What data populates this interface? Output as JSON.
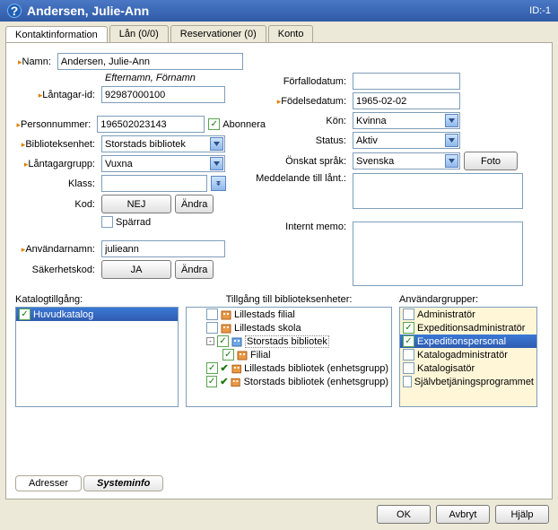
{
  "title": "Andersen, Julie-Ann",
  "id_label": "ID:-1",
  "tabs": [
    "Kontaktinformation",
    "Lån (0/0)",
    "Reservationer (0)",
    "Konto"
  ],
  "labels": {
    "namn": "Namn:",
    "efternamn_hint": "Efternamn, Förnamn",
    "lantagarid": "Låntagar-id:",
    "personnummer": "Personnummer:",
    "abonnera": "Abonnera",
    "biblioteksenhet": "Biblioteksenhet:",
    "lantagargrupp": "Låntagargrupp:",
    "klass": "Klass:",
    "kod": "Kod:",
    "sparrad": "Spärrad",
    "anvandarnamn": "Användarnamn:",
    "sakerhetskod": "Säkerhetskod:",
    "forfallodatum": "Förfallodatum:",
    "fodelsedatum": "Födelsedatum:",
    "kon": "Kön:",
    "status": "Status:",
    "onskat_sprak": "Önskat språk:",
    "meddelande": "Meddelande till lånt.:",
    "internt_memo": "Internt memo:",
    "katalogtillgang": "Katalogtillgång:",
    "tillgang_enheter": "Tillgång till biblioteksenheter:",
    "anvandargrupper": "Användargrupper:"
  },
  "values": {
    "namn": "Andersen, Julie-Ann",
    "lantagarid": "92987000100",
    "personnummer": "196502023143",
    "biblioteksenhet": "Storstads bibliotek",
    "lantagargrupp": "Vuxna",
    "klass": "",
    "kod": "NEJ",
    "anvandarnamn": "julieann",
    "sakerhetskod": "JA",
    "forfallodatum": "",
    "fodelsedatum": "1965-02-02",
    "kon": "Kvinna",
    "status": "Aktiv",
    "onskat_sprak": "Svenska"
  },
  "buttons": {
    "andra": "Ändra",
    "foto": "Foto",
    "ok": "OK",
    "avbryt": "Avbryt",
    "hjalp": "Hjälp"
  },
  "katalog_items": [
    "Huvudkatalog"
  ],
  "tree": [
    {
      "level": 1,
      "checked": false,
      "icon": "orange",
      "label": "Lillestads filial"
    },
    {
      "level": 1,
      "checked": false,
      "icon": "orange",
      "label": "Lillestads skola"
    },
    {
      "level": 1,
      "checked": true,
      "icon": "blue",
      "label": "Storstads bibliotek",
      "expander": "-",
      "boxed": true
    },
    {
      "level": 2,
      "checked": true,
      "icon": "orange",
      "label": "Filial"
    },
    {
      "level": 1,
      "checked": true,
      "icon": "orange",
      "label": "Lillestads bibliotek (enhetsgrupp)",
      "greencheck": true
    },
    {
      "level": 1,
      "checked": true,
      "icon": "orange",
      "label": "Storstads bibliotek (enhetsgrupp)",
      "greencheck": true
    }
  ],
  "user_groups": [
    {
      "checked": false,
      "label": "Administratör"
    },
    {
      "checked": true,
      "label": "Expeditionsadministratör"
    },
    {
      "checked": true,
      "label": "Expeditionspersonal",
      "selected": true
    },
    {
      "checked": false,
      "label": "Katalogadministratör"
    },
    {
      "checked": false,
      "label": "Katalogisatör"
    },
    {
      "checked": false,
      "label": "Självbetjäningsprogrammet"
    }
  ],
  "bottom_tabs": [
    "Adresser",
    "Systeminfo"
  ]
}
